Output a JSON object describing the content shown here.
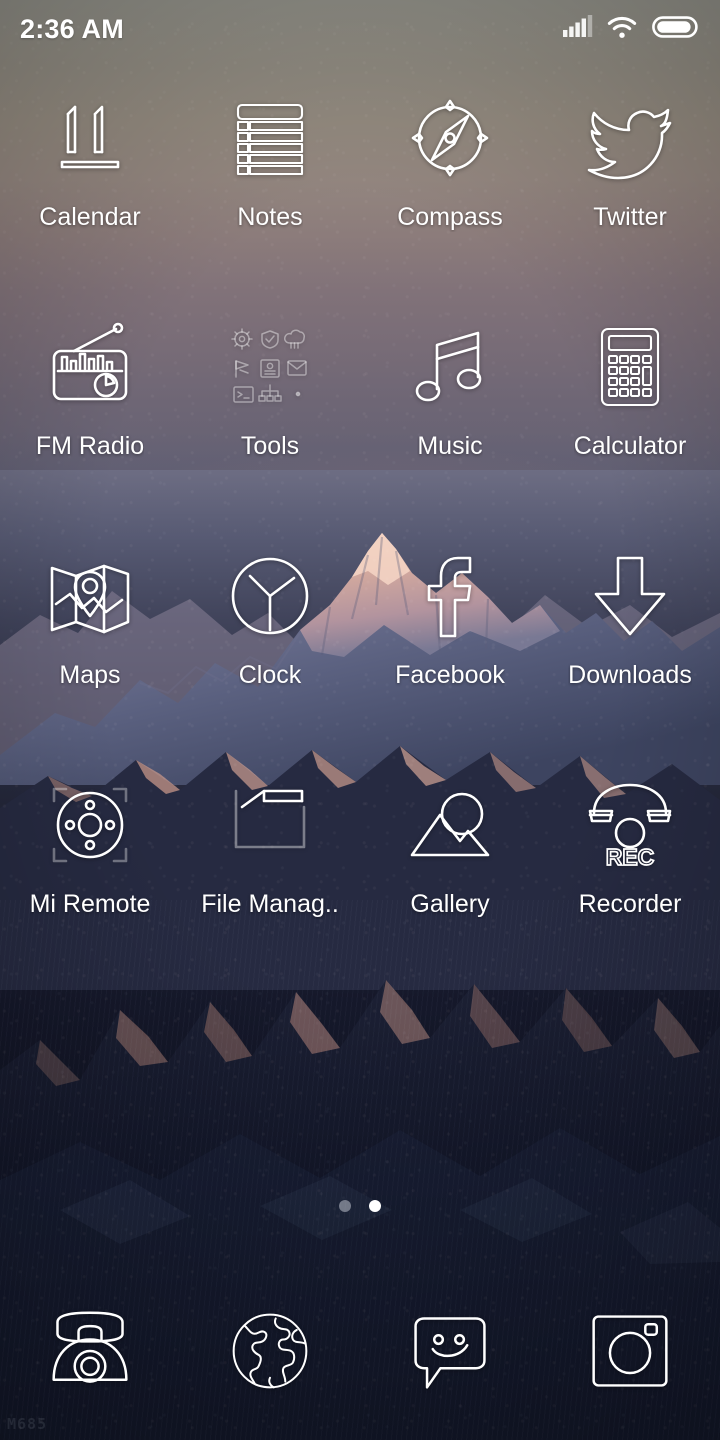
{
  "status_bar": {
    "time": "2:36 AM",
    "icons": [
      {
        "name": "signal-icon",
        "label": "cellular signal"
      },
      {
        "name": "wifi-icon",
        "label": "wifi"
      },
      {
        "name": "battery-icon",
        "label": "battery"
      }
    ]
  },
  "home_screen": {
    "apps": [
      {
        "label": "Calendar",
        "icon": "calendar-icon",
        "badge": "11"
      },
      {
        "label": "Notes",
        "icon": "notes-icon"
      },
      {
        "label": "Compass",
        "icon": "compass-icon"
      },
      {
        "label": "Twitter",
        "icon": "twitter-icon"
      },
      {
        "label": "FM Radio",
        "icon": "fm-radio-icon"
      },
      {
        "label": "Tools",
        "icon": "tools-folder-icon"
      },
      {
        "label": "Music",
        "icon": "music-icon"
      },
      {
        "label": "Calculator",
        "icon": "calculator-icon"
      },
      {
        "label": "Maps",
        "icon": "maps-icon"
      },
      {
        "label": "Clock",
        "icon": "clock-icon"
      },
      {
        "label": "Facebook",
        "icon": "facebook-icon"
      },
      {
        "label": "Downloads",
        "icon": "downloads-icon"
      },
      {
        "label": "Mi Remote",
        "icon": "mi-remote-icon"
      },
      {
        "label": "File Manag..",
        "icon": "file-manager-icon"
      },
      {
        "label": "Gallery",
        "icon": "gallery-icon"
      },
      {
        "label": "Recorder",
        "icon": "recorder-icon",
        "badge": "REC"
      }
    ]
  },
  "page_indicator": {
    "total_pages": 2,
    "current_page": 2
  },
  "dock": {
    "apps": [
      {
        "label": "Phone",
        "icon": "phone-icon"
      },
      {
        "label": "Browser",
        "icon": "globe-icon"
      },
      {
        "label": "Messaging",
        "icon": "message-smiley-icon"
      },
      {
        "label": "Camera",
        "icon": "camera-icon"
      }
    ]
  },
  "watermark": {
    "text": "M685"
  },
  "colors": {
    "icon_stroke": "#ffffff",
    "label_text": "#ffffff",
    "active_dot": "#ffffff",
    "inactive_dot": "rgba(225,228,238,0.45)",
    "sky_top": "#8e8d85",
    "sky_bottom": "#585c70",
    "snow_lit": "#e3b3a4",
    "rock_shadow": "#2c3047"
  }
}
